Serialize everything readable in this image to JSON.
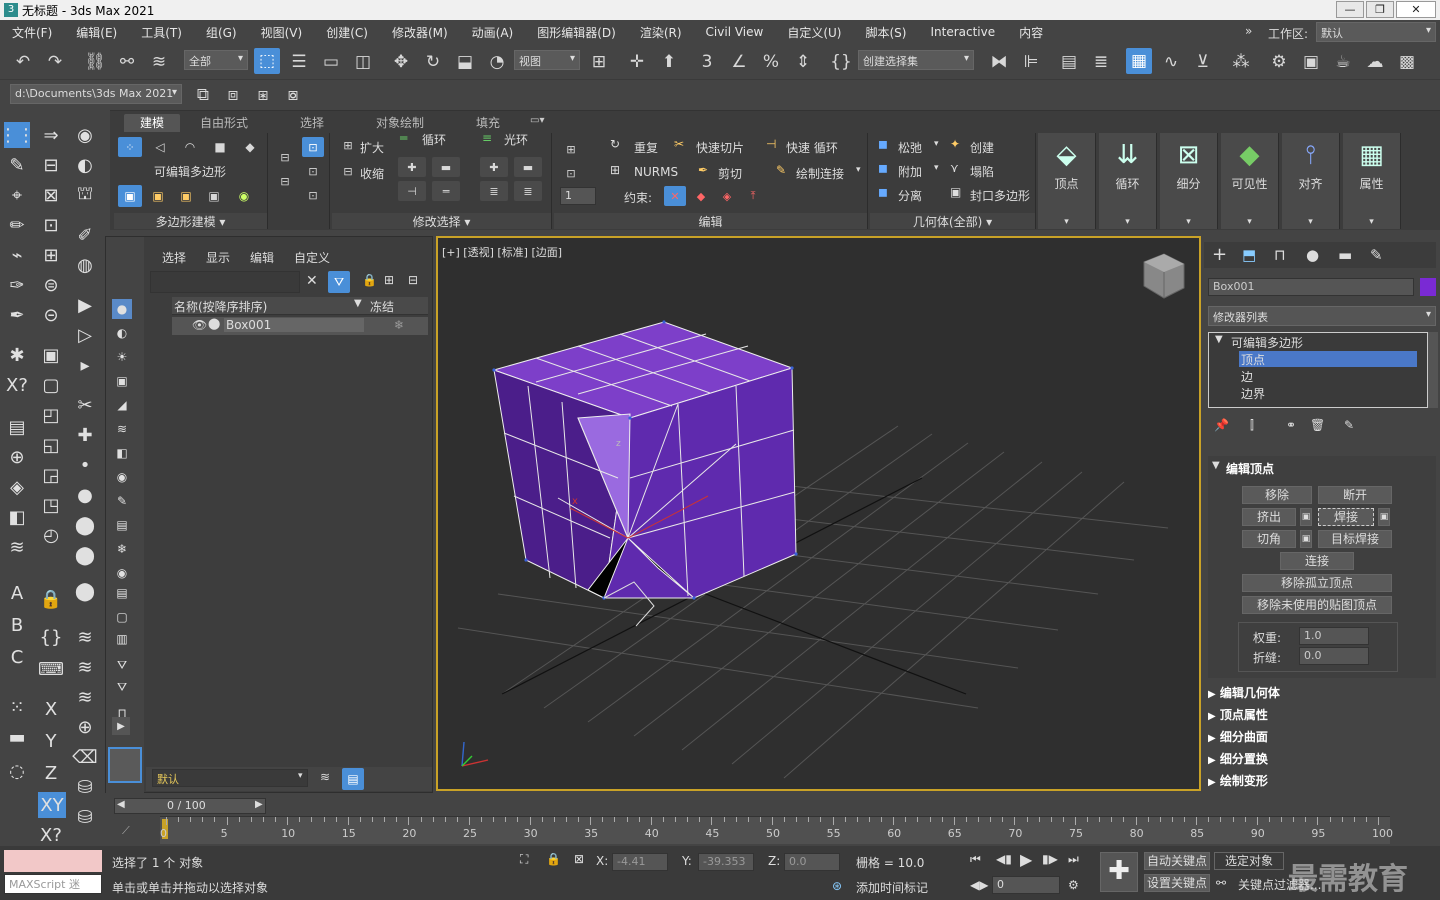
{
  "app": {
    "title": "无标题 - 3ds Max 2021"
  },
  "menu": [
    "文件(F)",
    "编辑(E)",
    "工具(T)",
    "组(G)",
    "视图(V)",
    "创建(C)",
    "修改器(M)",
    "动画(A)",
    "图形编辑器(D)",
    "渲染(R)",
    "Civil View",
    "自定义(U)",
    "脚本(S)",
    "Interactive",
    "内容"
  ],
  "workspace": {
    "label": "工作区:",
    "value": "默认"
  },
  "toolbar": {
    "filter": "全部",
    "refcoord": "视图",
    "selset": "创建选择集",
    "path": "d:\\Documents\\3ds Max 2021"
  },
  "ribbon": {
    "tabs": [
      "建模",
      "自由形式",
      "选择",
      "对象绘制",
      "填充"
    ],
    "g1": {
      "title": "可编辑多边形",
      "footer": "多边形建模"
    },
    "g2": {
      "expand": "扩大",
      "shrink": "收缩",
      "loop": "循环",
      "ring": "光环",
      "footer": "修改选择"
    },
    "g3": {
      "repeat": "重复",
      "quickslice": "快速切片",
      "quickloop": "快速 循环",
      "nurms": "NURMS",
      "cut": "剪切",
      "paintconnect": "绘制连接",
      "constraint": "约束:",
      "footer": "编辑"
    },
    "g4": {
      "relax": "松弛",
      "create": "创建",
      "attach": "附加",
      "collapse": "塌陷",
      "detach": "分离",
      "cap": "封口多边形",
      "footer": "几何体(全部)"
    },
    "big": [
      "顶点",
      "循环",
      "细分",
      "可见性",
      "对齐",
      "属性"
    ]
  },
  "scene": {
    "tabs": [
      "选择",
      "显示",
      "编辑",
      "自定义"
    ],
    "col_name": "名称(按降序排序)",
    "col_freeze": "冻结",
    "item": "Box001",
    "layer": "默认"
  },
  "viewport": {
    "label": "[+] [透视] [标准] [边面]"
  },
  "cmd": {
    "object": "Box001",
    "modlist": "修改器列表",
    "stack": [
      "可编辑多边形",
      "顶点",
      "边",
      "边界"
    ],
    "rollout_title": "编辑顶点",
    "buttons": [
      "移除",
      "断开",
      "挤出",
      "焊接",
      "切角",
      "目标焊接",
      "连接",
      "移除孤立顶点",
      "移除未使用的贴图顶点"
    ],
    "weight_label": "权重:",
    "weight": "1.0",
    "crease_label": "折缝:",
    "crease": "0.0",
    "rollouts": [
      "编辑几何体",
      "顶点属性",
      "细分曲面",
      "细分置换",
      "绘制变形"
    ]
  },
  "time": {
    "frame": "0 / 100",
    "ticks": [
      "0",
      "5",
      "10",
      "15",
      "20",
      "25",
      "30",
      "35",
      "40",
      "45",
      "50",
      "55",
      "60",
      "65",
      "70",
      "75",
      "80",
      "85",
      "90",
      "95",
      "100"
    ]
  },
  "status": {
    "maxscript": "MAXScript 迷",
    "selected": "选择了 1 个 对象",
    "hint": "单击或单击并拖动以选择对象",
    "x_label": "X:",
    "x": "-4.41",
    "y_label": "Y:",
    "y": "-39.353",
    "z_label": "Z:",
    "z": "0.0",
    "grid": "栅格 = 10.0",
    "addtime": "添加时间标记",
    "autokey": "自动关键点",
    "selobj": "选定对象",
    "setkey": "设置关键点",
    "keyfilter": "关键点过滤器...",
    "frame": "0",
    "watermark": "最需教育"
  }
}
